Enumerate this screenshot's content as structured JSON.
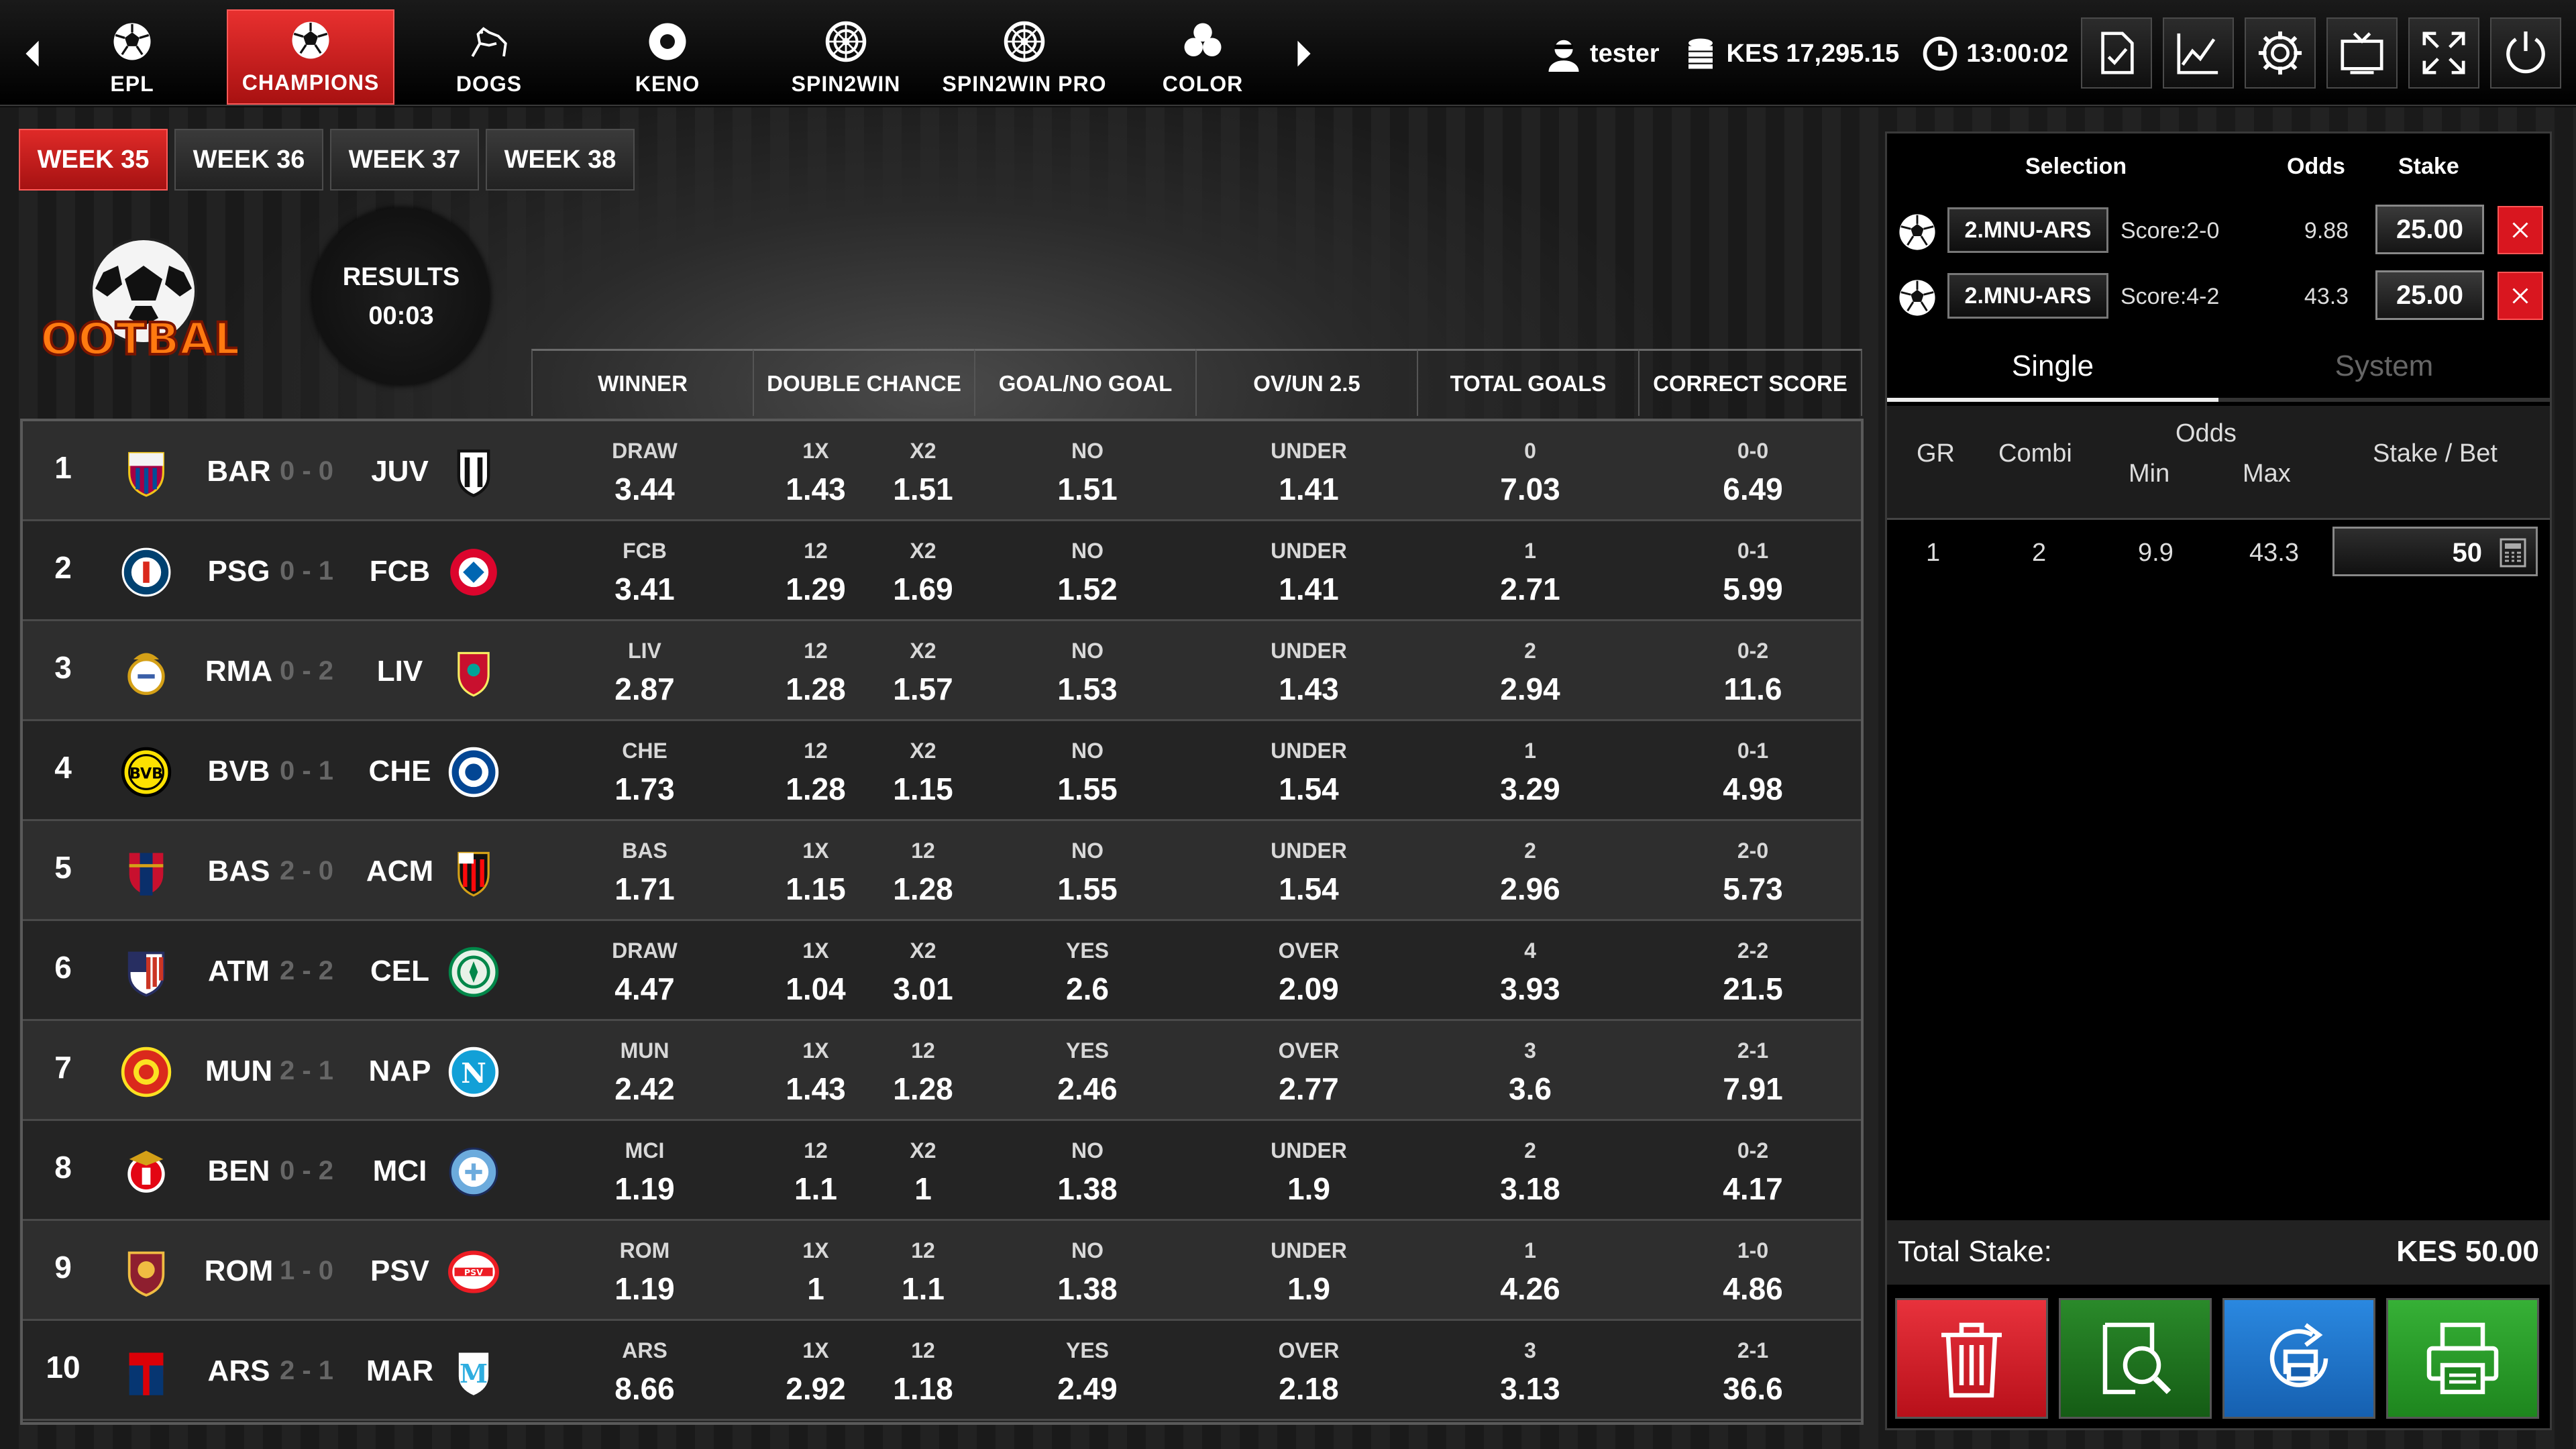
{
  "nav": {
    "tabs": [
      {
        "label": "EPL",
        "icon": "soccer-ball-icon"
      },
      {
        "label": "CHAMPIONS",
        "icon": "soccer-ball-icon",
        "active": true
      },
      {
        "label": "DOGS",
        "icon": "greyhound-icon"
      },
      {
        "label": "KENO",
        "icon": "keno-ball-icon"
      },
      {
        "label": "SPIN2WIN",
        "icon": "roulette-icon"
      },
      {
        "label": "SPIN2WIN PRO",
        "icon": "roulette-icon"
      },
      {
        "label": "COLOR",
        "icon": "color-balls-icon"
      }
    ]
  },
  "user": {
    "name": "tester",
    "balance": "KES 17,295.15",
    "time": "13:00:02"
  },
  "toolbar": [
    "ticket-check-icon",
    "chart-icon",
    "gear-icon",
    "tv-icon",
    "fullscreen-icon",
    "power-icon"
  ],
  "weeks": [
    {
      "label": "WEEK 35",
      "active": true
    },
    {
      "label": "WEEK 36"
    },
    {
      "label": "WEEK 37"
    },
    {
      "label": "WEEK 38"
    }
  ],
  "logo_text": "FOOTBALL",
  "results": {
    "label": "RESULTS",
    "timer": "00:03"
  },
  "columns": [
    "WINNER",
    "DOUBLE CHANCE",
    "GOAL/NO GOAL",
    "OV/UN 2.5",
    "TOTAL GOALS",
    "CORRECT SCORE"
  ],
  "matches": [
    {
      "no": "1",
      "home": "BAR",
      "hs": "0",
      "as": "0",
      "away": "JUV",
      "hb": "barcelona",
      "ab": "juventus",
      "w_l": "DRAW",
      "w_v": "3.44",
      "d1_l": "1X",
      "d1_v": "1.43",
      "d2_l": "X2",
      "d2_v": "1.51",
      "g_l": "NO",
      "g_v": "1.51",
      "o_l": "UNDER",
      "o_v": "1.41",
      "t_l": "0",
      "t_v": "7.03",
      "cs_l": "0-0",
      "cs_v": "6.49"
    },
    {
      "no": "2",
      "home": "PSG",
      "hs": "0",
      "as": "1",
      "away": "FCB",
      "hb": "psg",
      "ab": "bayern",
      "w_l": "FCB",
      "w_v": "3.41",
      "d1_l": "12",
      "d1_v": "1.29",
      "d2_l": "X2",
      "d2_v": "1.69",
      "g_l": "NO",
      "g_v": "1.52",
      "o_l": "UNDER",
      "o_v": "1.41",
      "t_l": "1",
      "t_v": "2.71",
      "cs_l": "0-1",
      "cs_v": "5.99"
    },
    {
      "no": "3",
      "home": "RMA",
      "hs": "0",
      "as": "2",
      "away": "LIV",
      "hb": "realmadrid",
      "ab": "liverpool",
      "w_l": "LIV",
      "w_v": "2.87",
      "d1_l": "12",
      "d1_v": "1.28",
      "d2_l": "X2",
      "d2_v": "1.57",
      "g_l": "NO",
      "g_v": "1.53",
      "o_l": "UNDER",
      "o_v": "1.43",
      "t_l": "2",
      "t_v": "2.94",
      "cs_l": "0-2",
      "cs_v": "11.6"
    },
    {
      "no": "4",
      "home": "BVB",
      "hs": "0",
      "as": "1",
      "away": "CHE",
      "hb": "dortmund",
      "ab": "chelsea",
      "w_l": "CHE",
      "w_v": "1.73",
      "d1_l": "12",
      "d1_v": "1.28",
      "d2_l": "X2",
      "d2_v": "1.15",
      "g_l": "NO",
      "g_v": "1.55",
      "o_l": "UNDER",
      "o_v": "1.54",
      "t_l": "1",
      "t_v": "3.29",
      "cs_l": "0-1",
      "cs_v": "4.98"
    },
    {
      "no": "5",
      "home": "BAS",
      "hs": "2",
      "as": "0",
      "away": "ACM",
      "hb": "basel",
      "ab": "acmilan",
      "w_l": "BAS",
      "w_v": "1.71",
      "d1_l": "1X",
      "d1_v": "1.15",
      "d2_l": "12",
      "d2_v": "1.28",
      "g_l": "NO",
      "g_v": "1.55",
      "o_l": "UNDER",
      "o_v": "1.54",
      "t_l": "2",
      "t_v": "2.96",
      "cs_l": "2-0",
      "cs_v": "5.73"
    },
    {
      "no": "6",
      "home": "ATM",
      "hs": "2",
      "as": "2",
      "away": "CEL",
      "hb": "atletico",
      "ab": "celtic",
      "w_l": "DRAW",
      "w_v": "4.47",
      "d1_l": "1X",
      "d1_v": "1.04",
      "d2_l": "X2",
      "d2_v": "3.01",
      "g_l": "YES",
      "g_v": "2.6",
      "o_l": "OVER",
      "o_v": "2.09",
      "t_l": "4",
      "t_v": "3.93",
      "cs_l": "2-2",
      "cs_v": "21.5"
    },
    {
      "no": "7",
      "home": "MUN",
      "hs": "2",
      "as": "1",
      "away": "NAP",
      "hb": "manutd",
      "ab": "napoli",
      "w_l": "MUN",
      "w_v": "2.42",
      "d1_l": "1X",
      "d1_v": "1.43",
      "d2_l": "12",
      "d2_v": "1.28",
      "g_l": "YES",
      "g_v": "2.46",
      "o_l": "OVER",
      "o_v": "2.77",
      "t_l": "3",
      "t_v": "3.6",
      "cs_l": "2-1",
      "cs_v": "7.91"
    },
    {
      "no": "8",
      "home": "BEN",
      "hs": "0",
      "as": "2",
      "away": "MCI",
      "hb": "benfica",
      "ab": "mancity",
      "w_l": "MCI",
      "w_v": "1.19",
      "d1_l": "12",
      "d1_v": "1.1",
      "d2_l": "X2",
      "d2_v": "1",
      "g_l": "NO",
      "g_v": "1.38",
      "o_l": "UNDER",
      "o_v": "1.9",
      "t_l": "2",
      "t_v": "3.18",
      "cs_l": "0-2",
      "cs_v": "4.17"
    },
    {
      "no": "9",
      "home": "ROM",
      "hs": "1",
      "as": "0",
      "away": "PSV",
      "hb": "roma",
      "ab": "psv",
      "w_l": "ROM",
      "w_v": "1.19",
      "d1_l": "1X",
      "d1_v": "1",
      "d2_l": "12",
      "d2_v": "1.1",
      "g_l": "NO",
      "g_v": "1.38",
      "o_l": "UNDER",
      "o_v": "1.9",
      "t_l": "1",
      "t_v": "4.26",
      "cs_l": "1-0",
      "cs_v": "4.86"
    },
    {
      "no": "10",
      "home": "ARS",
      "hs": "2",
      "as": "1",
      "away": "MAR",
      "hb": "arsenal",
      "ab": "marseille",
      "w_l": "ARS",
      "w_v": "8.66",
      "d1_l": "1X",
      "d1_v": "2.92",
      "d2_l": "12",
      "d2_v": "1.18",
      "g_l": "YES",
      "g_v": "2.49",
      "o_l": "OVER",
      "o_v": "2.18",
      "t_l": "3",
      "t_v": "3.13",
      "cs_l": "2-1",
      "cs_v": "36.6"
    }
  ],
  "slip": {
    "headers": {
      "selection": "Selection",
      "odds": "Odds",
      "stake": "Stake"
    },
    "selections": [
      {
        "match": "2.MNU-ARS",
        "score": "Score:2-0",
        "odds": "9.88",
        "stake": "25.00"
      },
      {
        "match": "2.MNU-ARS",
        "score": "Score:4-2",
        "odds": "43.3",
        "stake": "25.00"
      }
    ],
    "modes": {
      "single": "Single",
      "system": "System"
    },
    "system_headers": {
      "gr": "GR",
      "combi": "Combi",
      "odds": "Odds",
      "min": "Min",
      "max": "Max",
      "stake_bet": "Stake / Bet"
    },
    "system_row": {
      "gr": "1",
      "combi": "2",
      "min": "9.9",
      "max": "43.3",
      "stake": "50"
    },
    "total_label": "Total Stake:",
    "total_value": "KES 50.00",
    "actions": [
      {
        "name": "delete-button",
        "icon": "trash-icon",
        "color": "#d81f2a"
      },
      {
        "name": "search-ticket-button",
        "icon": "magnifier-ticket-icon",
        "color": "#1f7d1f"
      },
      {
        "name": "reprint-button",
        "icon": "reprint-icon",
        "color": "#1f74c9"
      },
      {
        "name": "print-button",
        "icon": "printer-icon",
        "color": "#2aa02a"
      }
    ]
  },
  "colors": {
    "accent": "#d8201f",
    "green": "#2aa02a",
    "blue": "#1f74c9"
  }
}
